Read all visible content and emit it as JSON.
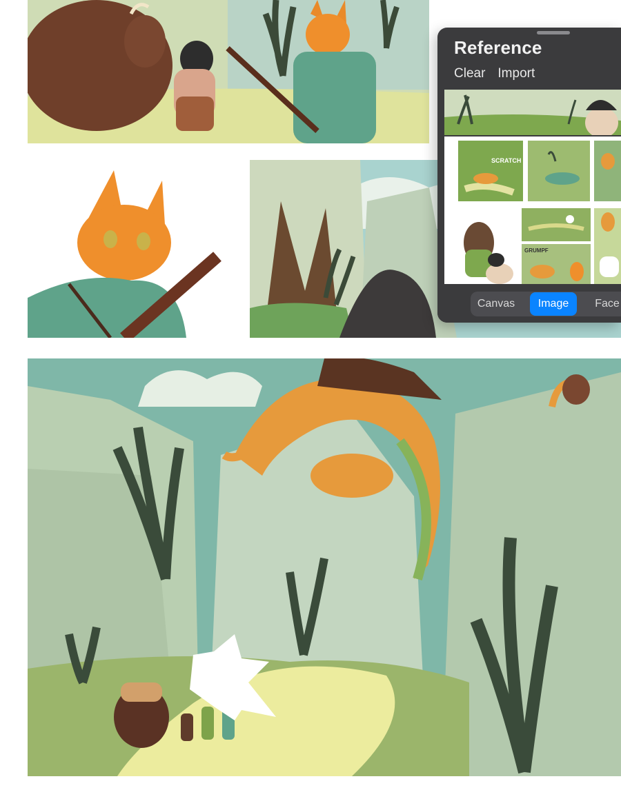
{
  "reference_panel": {
    "title": "Reference",
    "actions": {
      "clear": "Clear",
      "import": "Import"
    },
    "tabs": [
      {
        "label": "Canvas",
        "active": false
      },
      {
        "label": "Image",
        "active": true
      },
      {
        "label": "Face",
        "active": false
      }
    ],
    "thumbnail_sound_effects": {
      "scratch": "SCRATCH",
      "grumpf": "GRUMPF"
    }
  },
  "colors": {
    "accent": "#0a84ff",
    "panel_background": "#3b3b3d",
    "page_background": "#ffffff"
  }
}
